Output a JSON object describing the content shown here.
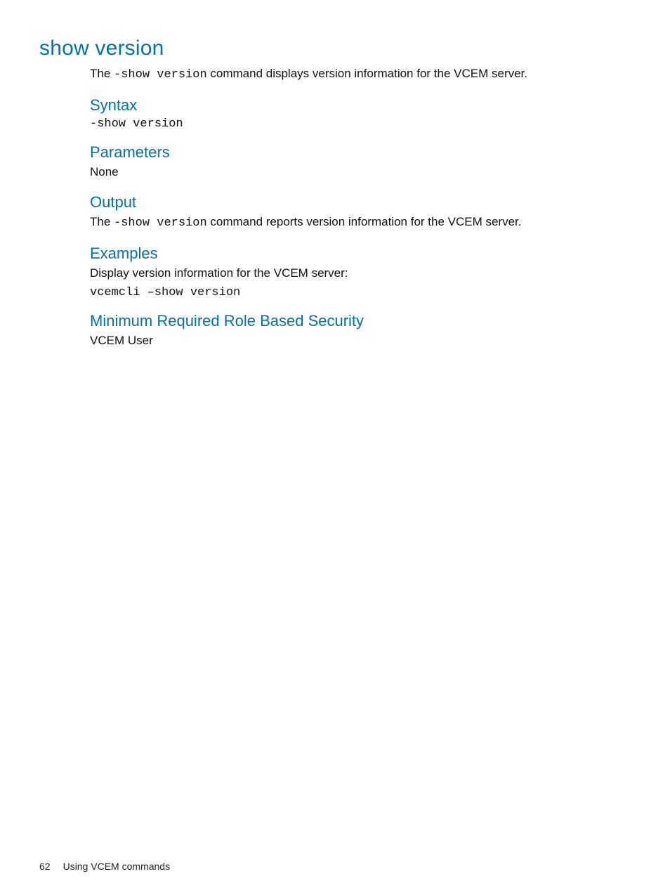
{
  "main": {
    "title": "show version",
    "intro_pre": "The ",
    "intro_code": "-show version",
    "intro_post": " command displays version information for the VCEM server.",
    "syntax_heading": "Syntax",
    "syntax_code": "-show version",
    "parameters_heading": "Parameters",
    "parameters_body": "None",
    "output_heading": "Output",
    "output_pre": "The ",
    "output_code": "-show version",
    "output_post": " command reports version information for the VCEM server.",
    "examples_heading": "Examples",
    "examples_body": "Display version information for the VCEM server:",
    "examples_code": "vcemcli –show version",
    "security_heading": "Minimum Required Role Based Security",
    "security_body": "VCEM User"
  },
  "footer": {
    "page_number": "62",
    "section": "Using VCEM commands"
  }
}
